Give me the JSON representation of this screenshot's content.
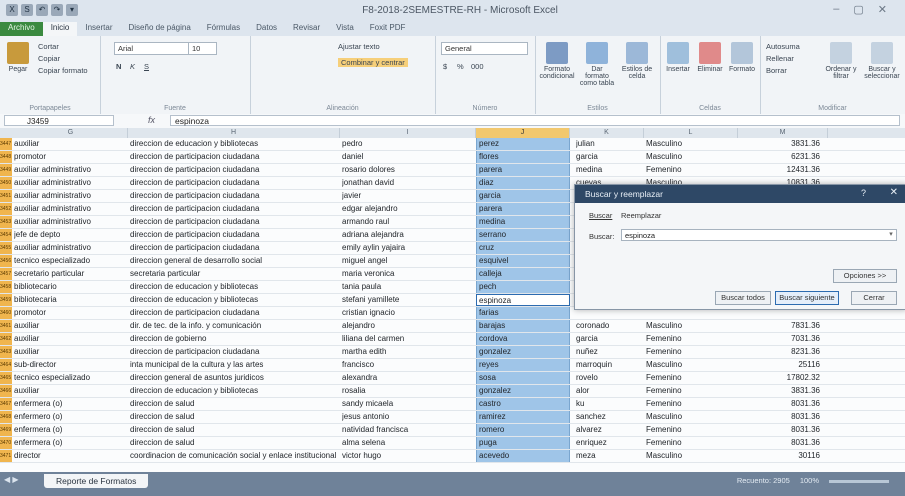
{
  "window": {
    "title": "F8-2018-2SEMESTRE-RH - Microsoft Excel",
    "controls": [
      "–",
      "▢",
      "✕"
    ]
  },
  "qat": [
    "X",
    "S",
    "↶",
    "↷",
    "▾"
  ],
  "tabs": [
    "Archivo",
    "Inicio",
    "Insertar",
    "Diseño de página",
    "Fórmulas",
    "Datos",
    "Revisar",
    "Vista",
    "Foxit PDF"
  ],
  "ribbon": {
    "clipboard": {
      "paste": "Pegar",
      "cut": "Cortar",
      "copy": "Copiar",
      "format": "Copiar formato",
      "label": "Portapapeles"
    },
    "font": {
      "name": "Arial",
      "size": "10",
      "label": "Fuente",
      "bold": "N",
      "italic": "K",
      "underline": "S"
    },
    "alignment": {
      "wrap": "Ajustar texto",
      "merge": "Combinar y centrar",
      "label": "Alineación"
    },
    "number": {
      "format": "General",
      "label": "Número",
      "currency": "$",
      "percent": "%",
      "thousands": "000"
    },
    "styles": {
      "conditional": "Formato condicional",
      "table": "Dar formato como tabla",
      "cell": "Estilos de celda",
      "label": "Estilos"
    },
    "cells": {
      "insert": "Insertar",
      "delete": "Eliminar",
      "format": "Formato",
      "label": "Celdas"
    },
    "editing": {
      "autosum": "Autosuma",
      "fill": "Rellenar",
      "clear": "Borrar",
      "sort": "Ordenar y filtrar",
      "find": "Buscar y seleccionar",
      "label": "Modificar"
    }
  },
  "formula_bar": {
    "name_box": "J3459",
    "fx": "fx",
    "value": "espinoza"
  },
  "columns": [
    "G",
    "H",
    "I",
    "J",
    "K",
    "L",
    "M"
  ],
  "rows": [
    {
      "n": "3447",
      "g": "auxiliar",
      "h": "direccion de educacion y bibliotecas",
      "i": "pedro",
      "j": "perez",
      "k": "julian",
      "l": "Masculino",
      "m": "3831.36"
    },
    {
      "n": "3448",
      "g": "promotor",
      "h": "direccion de participacion ciudadana",
      "i": "daniel",
      "j": "flores",
      "k": "garcia",
      "l": "Masculino",
      "m": "6231.36"
    },
    {
      "n": "3449",
      "g": "auxiliar administrativo",
      "h": "direccion de participacion ciudadana",
      "i": "rosario dolores",
      "j": "parera",
      "k": "medina",
      "l": "Femenino",
      "m": "12431.36"
    },
    {
      "n": "3450",
      "g": "auxiliar administrativo",
      "h": "direccion de participacion ciudadana",
      "i": "jonathan david",
      "j": "diaz",
      "k": "cuevas",
      "l": "Masculino",
      "m": "10831.36"
    },
    {
      "n": "3451",
      "g": "auxiliar administrativo",
      "h": "direccion de participacion ciudadana",
      "i": "javier",
      "j": "garcia",
      "k": "",
      "l": "",
      "m": ""
    },
    {
      "n": "3452",
      "g": "auxiliar administrativo",
      "h": "direccion de participacion ciudadana",
      "i": "edgar alejandro",
      "j": "parera",
      "k": "",
      "l": "",
      "m": ""
    },
    {
      "n": "3453",
      "g": "auxiliar administrativo",
      "h": "direccion de participacion ciudadana",
      "i": "armando raul",
      "j": "medina",
      "k": "",
      "l": "",
      "m": ""
    },
    {
      "n": "3454",
      "g": "jefe de depto",
      "h": "direccion de participacion ciudadana",
      "i": "adriana alejandra",
      "j": "serrano",
      "k": "",
      "l": "",
      "m": ""
    },
    {
      "n": "3455",
      "g": "auxiliar administrativo",
      "h": "direccion de participacion ciudadana",
      "i": "emily aylin yajaira",
      "j": "cruz",
      "k": "",
      "l": "",
      "m": ""
    },
    {
      "n": "3456",
      "g": "tecnico especializado",
      "h": "direccion general de desarrollo social",
      "i": "miguel angel",
      "j": "esquivel",
      "k": "",
      "l": "",
      "m": ""
    },
    {
      "n": "3457",
      "g": "secretario particular",
      "h": "secretaria particular",
      "i": "maria veronica",
      "j": "calleja",
      "k": "",
      "l": "",
      "m": ""
    },
    {
      "n": "3458",
      "g": "bibliotecario",
      "h": "direccion de educacion y bibliotecas",
      "i": "tania paula",
      "j": "pech",
      "k": "",
      "l": "",
      "m": ""
    },
    {
      "n": "3459",
      "g": "bibliotecaria",
      "h": "direccion de educacion y bibliotecas",
      "i": "stefani yamillete",
      "j": "espinoza",
      "k": "",
      "l": "",
      "m": ""
    },
    {
      "n": "3460",
      "g": "promotor",
      "h": "direccion de participacion ciudadana",
      "i": "cristian ignacio",
      "j": "farias",
      "k": "",
      "l": "",
      "m": ""
    },
    {
      "n": "3461",
      "g": "auxiliar",
      "h": "dir. de tec. de la info. y comunicación",
      "i": "alejandro",
      "j": "barajas",
      "k": "coronado",
      "l": "Masculino",
      "m": "7831.36"
    },
    {
      "n": "3462",
      "g": "auxiliar",
      "h": "direccion de gobierno",
      "i": "liliana del carmen",
      "j": "cordova",
      "k": "garcia",
      "l": "Femenino",
      "m": "7031.36"
    },
    {
      "n": "3463",
      "g": "auxiliar",
      "h": "direccion de participacion ciudadana",
      "i": "martha edith",
      "j": "gonzalez",
      "k": "nuñez",
      "l": "Femenino",
      "m": "8231.36"
    },
    {
      "n": "3464",
      "g": "sub-director",
      "h": "inta municipal de la cultura y las artes",
      "i": "francisco",
      "j": "reyes",
      "k": "marroquin",
      "l": "Masculino",
      "m": "25116"
    },
    {
      "n": "3465",
      "g": "tecnico especializado",
      "h": "direccion general de asuntos juridicos",
      "i": "alexandra",
      "j": "sosa",
      "k": "rovelo",
      "l": "Femenino",
      "m": "17802.32"
    },
    {
      "n": "3466",
      "g": "auxiliar",
      "h": "direccion de educacion y bibliotecas",
      "i": "rosalia",
      "j": "gonzalez",
      "k": "alor",
      "l": "Femenino",
      "m": "3831.36"
    },
    {
      "n": "3467",
      "g": "enfermera (o)",
      "h": "direccion de salud",
      "i": "sandy micaela",
      "j": "castro",
      "k": "ku",
      "l": "Femenino",
      "m": "8031.36"
    },
    {
      "n": "3468",
      "g": "enfermero (o)",
      "h": "direccion de salud",
      "i": "jesus antonio",
      "j": "ramirez",
      "k": "sanchez",
      "l": "Masculino",
      "m": "8031.36"
    },
    {
      "n": "3469",
      "g": "enfermera (o)",
      "h": "direccion de salud",
      "i": "natividad francisca",
      "j": "romero",
      "k": "alvarez",
      "l": "Femenino",
      "m": "8031.36"
    },
    {
      "n": "3470",
      "g": "enfermera (o)",
      "h": "direccion de salud",
      "i": "alma selena",
      "j": "puga",
      "k": "enriquez",
      "l": "Femenino",
      "m": "8031.36"
    },
    {
      "n": "3471",
      "g": "director",
      "h": "coordinacion de comunicación social y enlace institucional",
      "i": "victor hugo",
      "j": "acevedo",
      "k": "meza",
      "l": "Masculino",
      "m": "30116"
    }
  ],
  "active_row": "3459",
  "sheet_tab": "Reporte de Formatos",
  "status": {
    "count": "Recuento: 2905",
    "zoom": "100%"
  },
  "dialog": {
    "title": "Buscar y reemplazar",
    "help": "?",
    "close": "✕",
    "tab_find": "Buscar",
    "tab_replace": "Reemplazar",
    "find_label": "Buscar:",
    "find_value": "espinoza",
    "options": "Opciones >>",
    "find_all": "Buscar todos",
    "find_next": "Buscar siguiente",
    "cancel": "Cerrar"
  }
}
